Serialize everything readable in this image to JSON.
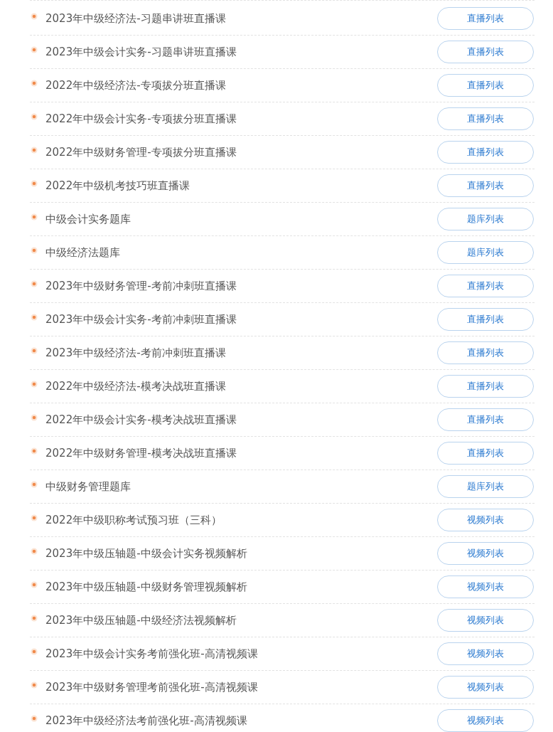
{
  "courses": [
    {
      "title": "2023年中级经济法-习题串讲班直播课",
      "action": "直播列表"
    },
    {
      "title": "2023年中级会计实务-习题串讲班直播课",
      "action": "直播列表"
    },
    {
      "title": "2022年中级经济法-专项拔分班直播课",
      "action": "直播列表"
    },
    {
      "title": "2022年中级会计实务-专项拔分班直播课",
      "action": "直播列表"
    },
    {
      "title": "2022年中级财务管理-专项拔分班直播课",
      "action": "直播列表"
    },
    {
      "title": "2022年中级机考技巧班直播课",
      "action": "直播列表"
    },
    {
      "title": "中级会计实务题库",
      "action": "题库列表"
    },
    {
      "title": "中级经济法题库",
      "action": "题库列表"
    },
    {
      "title": "2023年中级财务管理-考前冲刺班直播课",
      "action": "直播列表"
    },
    {
      "title": "2023年中级会计实务-考前冲刺班直播课",
      "action": "直播列表"
    },
    {
      "title": "2023年中级经济法-考前冲刺班直播课",
      "action": "直播列表"
    },
    {
      "title": "2022年中级经济法-模考决战班直播课",
      "action": "直播列表"
    },
    {
      "title": "2022年中级会计实务-模考决战班直播课",
      "action": "直播列表"
    },
    {
      "title": "2022年中级财务管理-模考决战班直播课",
      "action": "直播列表"
    },
    {
      "title": "中级财务管理题库",
      "action": "题库列表"
    },
    {
      "title": "2022年中级职称考试预习班（三科）",
      "action": "视频列表"
    },
    {
      "title": "2023年中级压轴题-中级会计实务视频解析",
      "action": "视频列表"
    },
    {
      "title": "2023年中级压轴题-中级财务管理视频解析",
      "action": "视频列表"
    },
    {
      "title": "2023年中级压轴题-中级经济法视频解析",
      "action": "视频列表"
    },
    {
      "title": "2023年中级会计实务考前强化班-高清视频课",
      "action": "视频列表"
    },
    {
      "title": "2023年中级财务管理考前强化班-高清视频课",
      "action": "视频列表"
    },
    {
      "title": "2023年中级经济法考前强化班-高清视频课",
      "action": "视频列表"
    }
  ]
}
